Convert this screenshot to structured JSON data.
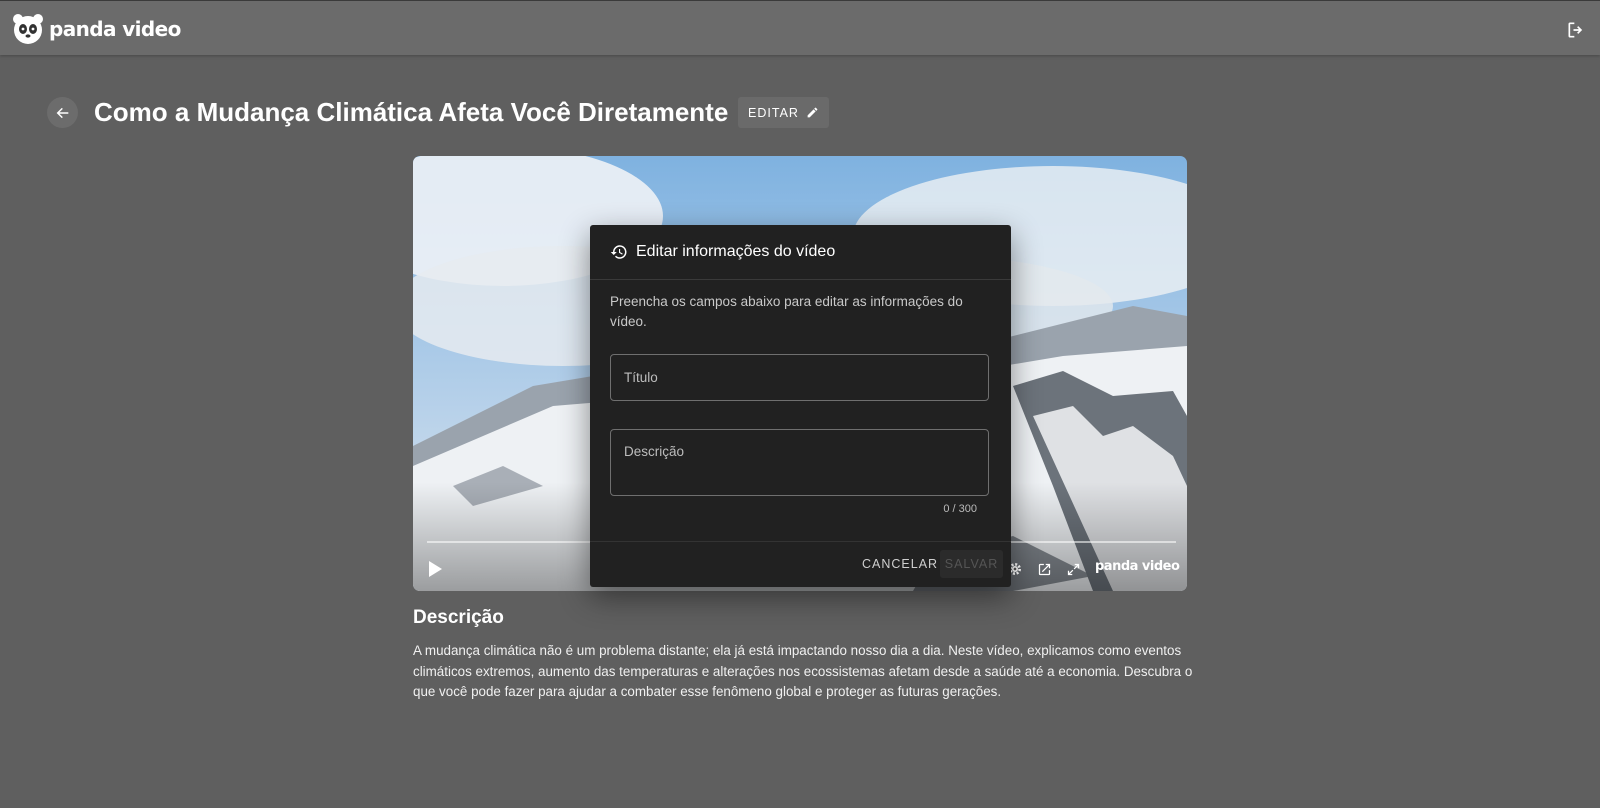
{
  "header": {
    "logo_text": "panda video",
    "logo_icon": "panda-logo-icon",
    "logout_icon": "logout-icon"
  },
  "page": {
    "back_icon": "arrow-left-icon",
    "title": "Como a Mudança Climática Afeta Você Diretamente",
    "edit_label": "EDITAR",
    "edit_icon": "pencil-icon"
  },
  "player": {
    "brand_text": "panda video",
    "controls": [
      "play-icon",
      "settings-icon",
      "open-in-new-icon",
      "fullscreen-icon"
    ]
  },
  "modal": {
    "title": "Editar informações do vídeo",
    "title_icon": "history-icon",
    "description": "Preencha os campos abaixo para editar as informações do vídeo.",
    "title_field_label": "Título",
    "description_field_label": "Descrição",
    "counter": "0 / 300",
    "cancel_label": "CANCELAR",
    "save_label": "SALVAR"
  },
  "description_section": {
    "heading": "Descrição",
    "text": "A mudança climática não é um problema distante; ela já está impactando nosso dia a dia. Neste vídeo, explicamos como eventos climáticos extremos, aumento das temperaturas e alterações nos ecossistemas afetam desde a saúde até a economia. Descubra o que você pode fazer para ajudar a combater esse fenômeno global e proteger as futuras gerações."
  },
  "colors": {
    "background": "#5f5f5f",
    "topbar": "#6b6b6b",
    "modal": "#212121"
  }
}
